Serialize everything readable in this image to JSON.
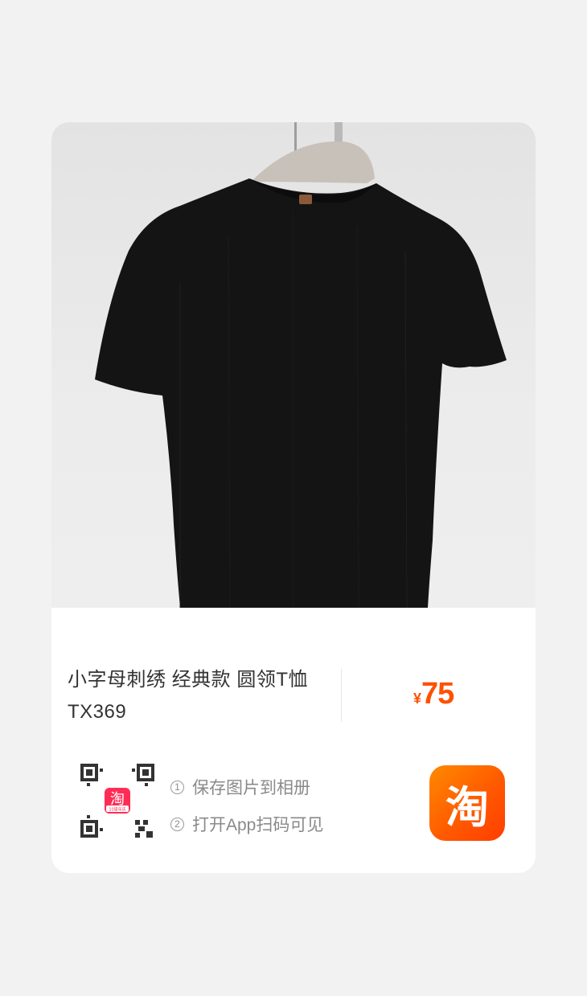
{
  "product": {
    "title": "小字母刺绣 经典款 圆领T恤 TX369",
    "price_currency": "¥",
    "price_value": "75"
  },
  "share": {
    "steps": [
      {
        "num": "1",
        "label": "保存图片到相册"
      },
      {
        "num": "2",
        "label": "打开App扫码可见"
      }
    ],
    "qr_center_logo": "淘",
    "qr_center_sub": "10周年庆",
    "app_badge_char": "淘"
  },
  "icons": {
    "app_badge": "taobao-app-icon",
    "qr": "qr-code-icon"
  },
  "colors": {
    "price": "#ff5000",
    "badge_start": "#ff8a00",
    "badge_end": "#ff3d00"
  }
}
